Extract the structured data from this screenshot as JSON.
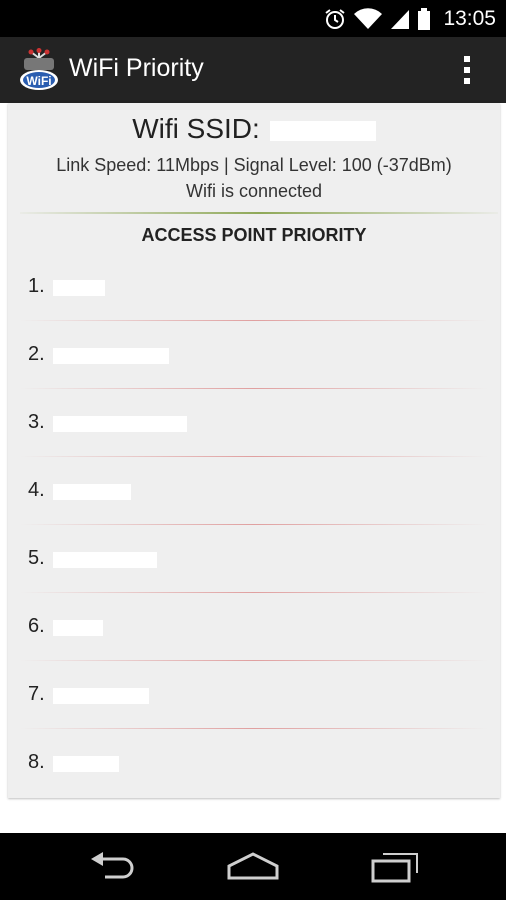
{
  "status_bar": {
    "time": "13:05"
  },
  "action_bar": {
    "title": "WiFi Priority",
    "icon_label": "WiFi"
  },
  "wifi_info": {
    "ssid_label": "Wifi SSID:",
    "link_speed_text": "Link Speed: 11Mbps | Signal Level: 100 (-37dBm)",
    "status_text": "Wifi is connected"
  },
  "access_points": {
    "header": "ACCESS POINT PRIORITY",
    "items": [
      {
        "label": "1."
      },
      {
        "label": "2."
      },
      {
        "label": "3."
      },
      {
        "label": "4."
      },
      {
        "label": "5."
      },
      {
        "label": "6."
      },
      {
        "label": "7."
      },
      {
        "label": "8."
      }
    ]
  },
  "colors": {
    "status_bar": "#000000",
    "action_bar": "#232323",
    "content_bg": "#efefef",
    "accent_divider": "#8fa858",
    "row_divider": "#e0a0a0"
  },
  "icons": [
    "alarm-icon",
    "wifi-signal-icon",
    "cell-signal-icon",
    "battery-icon",
    "overflow-menu-icon",
    "back-icon",
    "home-icon",
    "recents-icon"
  ]
}
